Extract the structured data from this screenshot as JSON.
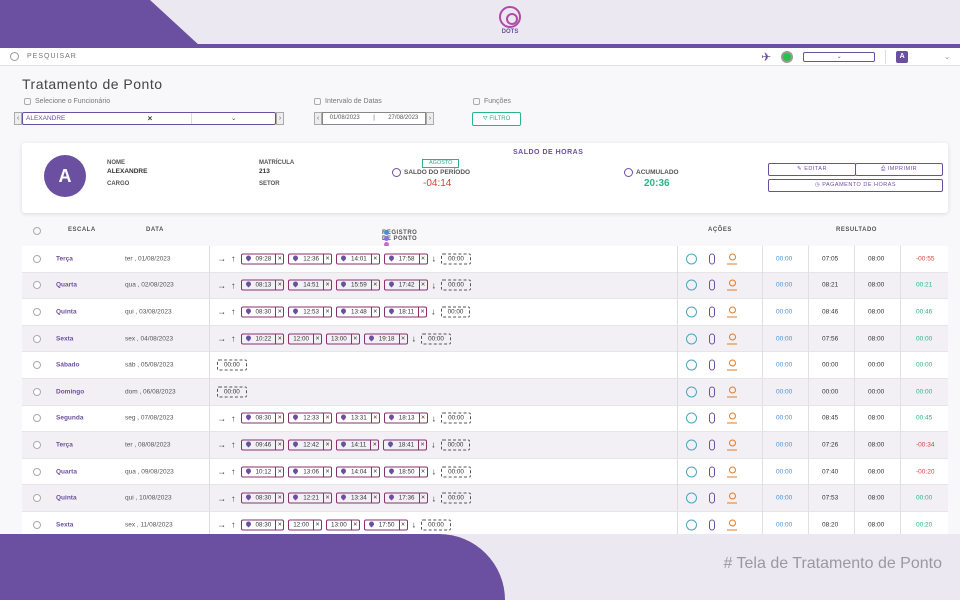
{
  "logo": {
    "text": "DOTS"
  },
  "topbar": {
    "search_placeholder": "PESQUISAR",
    "user_initial": "A"
  },
  "page": {
    "title": "Tratamento de Ponto"
  },
  "filters": {
    "employee_label": "Selecione o Funcionário",
    "employee_value": "ALEXANDRE",
    "dates_label": "Intervalo de Datas",
    "date_start": "01/08/2023",
    "date_sep": "|",
    "date_end": "27/08/2023",
    "functions_label": "Funções",
    "filter_button": "FILTRO"
  },
  "employee": {
    "initial": "A",
    "name_label": "NOME",
    "name": "ALEXANDRE",
    "role_label": "CARGO",
    "reg_label": "MATRÍCULA",
    "reg": "213",
    "sector_label": "SETOR"
  },
  "balance": {
    "title": "SALDO DE HORAS",
    "month": "AGOSTO",
    "period_label": "SALDO DO PERÍODO",
    "period_value": "-04:14",
    "acc_label": "ACUMULADO",
    "acc_value": "20:36"
  },
  "buttons": {
    "edit": "EDITAR",
    "print": "IMPRIMIR",
    "payment": "PAGAMENTO DE HORAS"
  },
  "table": {
    "headers": {
      "escala": "ESCALA",
      "data": "DATA",
      "registro": "REGISTRO DE PONTO",
      "acoes": "AÇÕES",
      "resultado": "RESULTADO"
    },
    "dot_colors": [
      "#4a8fd0",
      "#8a6fe0",
      "#c06fd0",
      "#e08ab0",
      "#e0a050",
      "#8b2f2f",
      "#e07b2b"
    ],
    "rows": [
      {
        "escala": "Terça",
        "data": "ter , 01/08/2023",
        "punches": [
          [
            "09:28",
            true
          ],
          [
            "12:36",
            true
          ],
          [
            "14:01",
            true
          ],
          [
            "17:58",
            true
          ]
        ],
        "total": "00:00",
        "r1": "00:00",
        "r2": "07:05",
        "r3": "08:00",
        "r4": "-00:55",
        "neg": true
      },
      {
        "escala": "Quarta",
        "data": "qua , 02/08/2023",
        "punches": [
          [
            "08:13",
            true
          ],
          [
            "14:51",
            true
          ],
          [
            "15:59",
            true
          ],
          [
            "17:42",
            true
          ]
        ],
        "total": "00:00",
        "r1": "00:00",
        "r2": "08:21",
        "r3": "08:00",
        "r4": "00:21",
        "neg": false
      },
      {
        "escala": "Quinta",
        "data": "qui , 03/08/2023",
        "punches": [
          [
            "08:30",
            true
          ],
          [
            "12:53",
            true
          ],
          [
            "13:48",
            true
          ],
          [
            "18:11",
            true
          ]
        ],
        "total": "00:00",
        "r1": "00:00",
        "r2": "08:46",
        "r3": "08:00",
        "r4": "00:46",
        "neg": false
      },
      {
        "escala": "Sexta",
        "data": "sex , 04/08/2023",
        "punches": [
          [
            "10:22",
            true
          ],
          [
            "12:00",
            false
          ],
          [
            "13:00",
            false
          ],
          [
            "19:18",
            true
          ]
        ],
        "total": "00:00",
        "r1": "00:00",
        "r2": "07:56",
        "r3": "08:00",
        "r4": "00:00",
        "neg": false
      },
      {
        "escala": "Sábado",
        "data": "sáb , 05/08/2023",
        "punches": [],
        "total": "00:00",
        "r1": "00:00",
        "r2": "00:00",
        "r3": "00:00",
        "r4": "00:00",
        "neg": false
      },
      {
        "escala": "Domingo",
        "data": "dom , 06/08/2023",
        "punches": [],
        "total": "00:00",
        "r1": "00:00",
        "r2": "00:00",
        "r3": "00:00",
        "r4": "00:00",
        "neg": false
      },
      {
        "escala": "Segunda",
        "data": "seg , 07/08/2023",
        "punches": [
          [
            "08:30",
            true
          ],
          [
            "12:33",
            true
          ],
          [
            "13:31",
            true
          ],
          [
            "18:13",
            true
          ]
        ],
        "total": "00:00",
        "r1": "00:00",
        "r2": "08:45",
        "r3": "08:00",
        "r4": "00:45",
        "neg": false
      },
      {
        "escala": "Terça",
        "data": "ter , 08/08/2023",
        "punches": [
          [
            "09:46",
            true
          ],
          [
            "12:42",
            true
          ],
          [
            "14:11",
            true
          ],
          [
            "18:41",
            true
          ]
        ],
        "total": "00:00",
        "r1": "00:00",
        "r2": "07:26",
        "r3": "08:00",
        "r4": "-00:34",
        "neg": true
      },
      {
        "escala": "Quarta",
        "data": "qua , 09/08/2023",
        "punches": [
          [
            "10:12",
            true
          ],
          [
            "13:06",
            true
          ],
          [
            "14:04",
            true
          ],
          [
            "18:50",
            true
          ]
        ],
        "total": "00:00",
        "r1": "00:00",
        "r2": "07:40",
        "r3": "08:00",
        "r4": "-00:20",
        "neg": true
      },
      {
        "escala": "Quinta",
        "data": "qui , 10/08/2023",
        "punches": [
          [
            "08:30",
            true
          ],
          [
            "12:21",
            true
          ],
          [
            "13:34",
            true
          ],
          [
            "17:36",
            true
          ]
        ],
        "total": "00:00",
        "r1": "00:00",
        "r2": "07:53",
        "r3": "08:00",
        "r4": "00:00",
        "neg": false
      },
      {
        "escala": "Sexta",
        "data": "sex , 11/08/2023",
        "punches": [
          [
            "08:30",
            true
          ],
          [
            "12:00",
            false
          ],
          [
            "13:00",
            false
          ],
          [
            "17:50",
            true
          ]
        ],
        "total": "00:00",
        "r1": "00:00",
        "r2": "08:20",
        "r3": "08:00",
        "r4": "00:20",
        "neg": false
      }
    ]
  },
  "caption": "# Tela de Tratamento de Ponto"
}
